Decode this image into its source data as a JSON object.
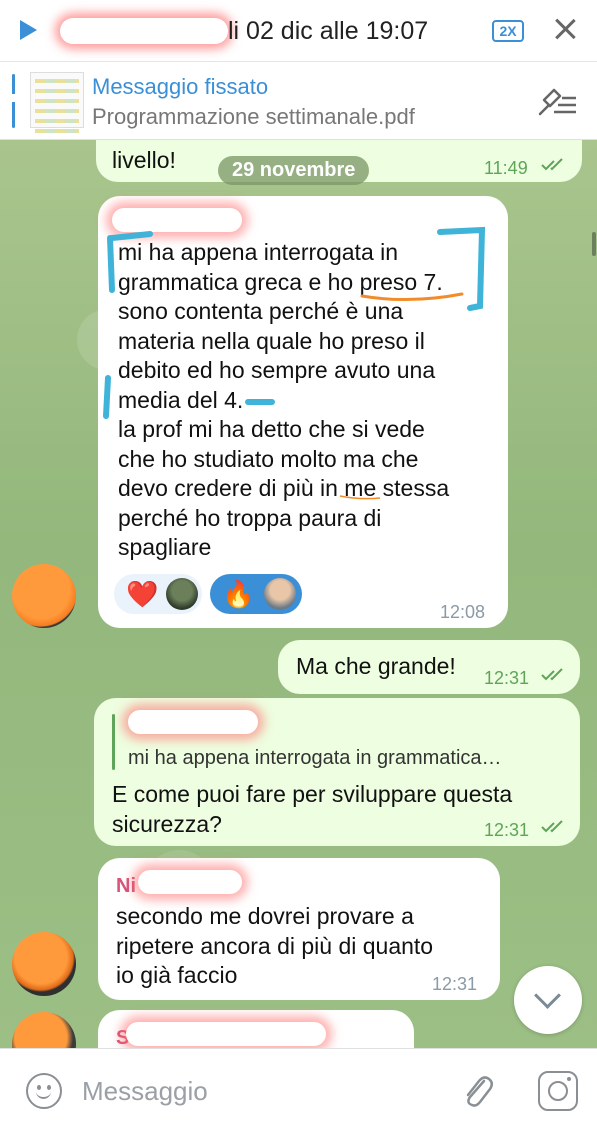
{
  "topbar": {
    "title": "li 02 dic alle 19:07",
    "speed": "2X"
  },
  "pinned": {
    "title": "Messaggio fissato",
    "subtitle": "Programmazione settimanale.pdf"
  },
  "chat": {
    "date_chip": "29 novembre",
    "top_partial": {
      "text": "livello!",
      "time": "11:49"
    },
    "msg1": {
      "lines": [
        "mi ha appena interrogata in",
        "grammatica greca e ho preso 7.",
        "sono contenta perché è una",
        "materia nella quale ho preso il",
        "debito ed ho sempre avuto una",
        "media del 4.",
        "la prof mi ha detto che si vede",
        "che ho studiato molto ma che",
        "devo credere di più in me stessa",
        "perché ho troppa paura di",
        "spagliare"
      ],
      "time": "12:08",
      "reactions": [
        {
          "emoji": "❤️",
          "avatar": "reactor-avatar-1"
        },
        {
          "emoji": "🔥",
          "avatar": "reactor-avatar-2"
        }
      ]
    },
    "msg2": {
      "text": "Ma che grande!",
      "time": "12:31"
    },
    "msg3": {
      "reply_preview": "mi ha appena interrogata in grammatica…",
      "lines": [
        "E come puoi fare per sviluppare questa",
        "sicurezza?"
      ],
      "time": "12:31"
    },
    "msg4": {
      "sender_initial": "Ni",
      "lines": [
        "secondo me dovrei provare a",
        "ripetere ancora di più di quanto",
        "io già faccio"
      ],
      "time": "12:31"
    },
    "msg5": {
      "sender_initial": "S"
    }
  },
  "input": {
    "placeholder": "Messaggio"
  },
  "icons": {
    "play": "play-icon",
    "close": "close-icon",
    "pin_list": "pinned-list-icon",
    "ticks": "double-check-icon",
    "scroll_down": "chevron-down-icon",
    "emoji": "emoji-icon",
    "attach": "paperclip-icon",
    "camera": "camera-icon"
  },
  "colors": {
    "accent": "#3a8fd6",
    "outgoing_bubble": "#eefee0",
    "read_ticks": "#5ea55a",
    "chat_background": "#9cbf85"
  }
}
